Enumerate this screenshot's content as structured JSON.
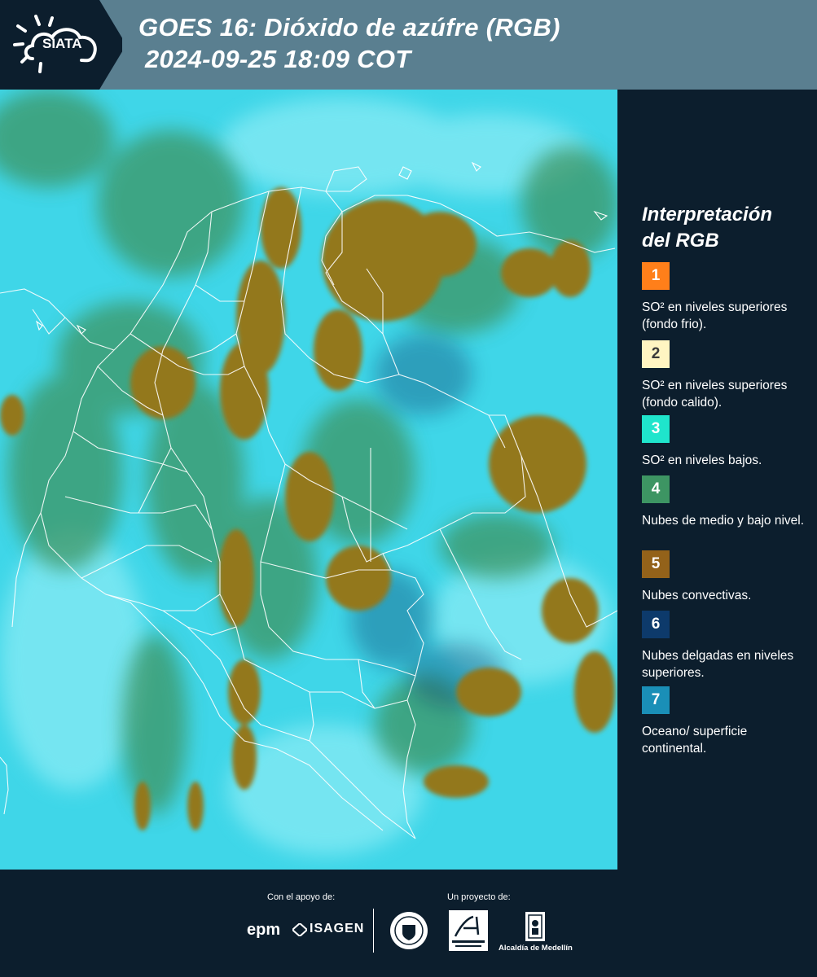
{
  "header": {
    "logo_text": "SIATA",
    "title_line1": "GOES 16: Dióxido de azúfre (RGB)",
    "title_line2": "2024-09-25 18:09 COT"
  },
  "legend": {
    "title": "Interpretación del RGB",
    "items": [
      {
        "number": "1",
        "color": "#ff7f1a",
        "text": "SO² en niveles superiores (fondo frio)."
      },
      {
        "number": "2",
        "color": "#fff5c2",
        "text": "SO² en niveles superiores (fondo calido)."
      },
      {
        "number": "3",
        "color": "#1fe5cc",
        "text": "SO² en niveles bajos."
      },
      {
        "number": "4",
        "color": "#3d9563",
        "text": "Nubes de medio y bajo nivel."
      },
      {
        "number": "5",
        "color": "#93621a",
        "text": "Nubes convectivas."
      },
      {
        "number": "6",
        "color": "#0d3a6b",
        "text": "Nubes delgadas en niveles superiores."
      },
      {
        "number": "7",
        "color": "#1a8fb7",
        "text": "Oceano/ superficie continental."
      }
    ]
  },
  "footer": {
    "support_caption": "Con el apoyo de:",
    "project_caption": "Un proyecto de:",
    "epm": "epm",
    "isagen": "ISAGEN",
    "alcaldia": "Alcaldía de Medellín"
  }
}
